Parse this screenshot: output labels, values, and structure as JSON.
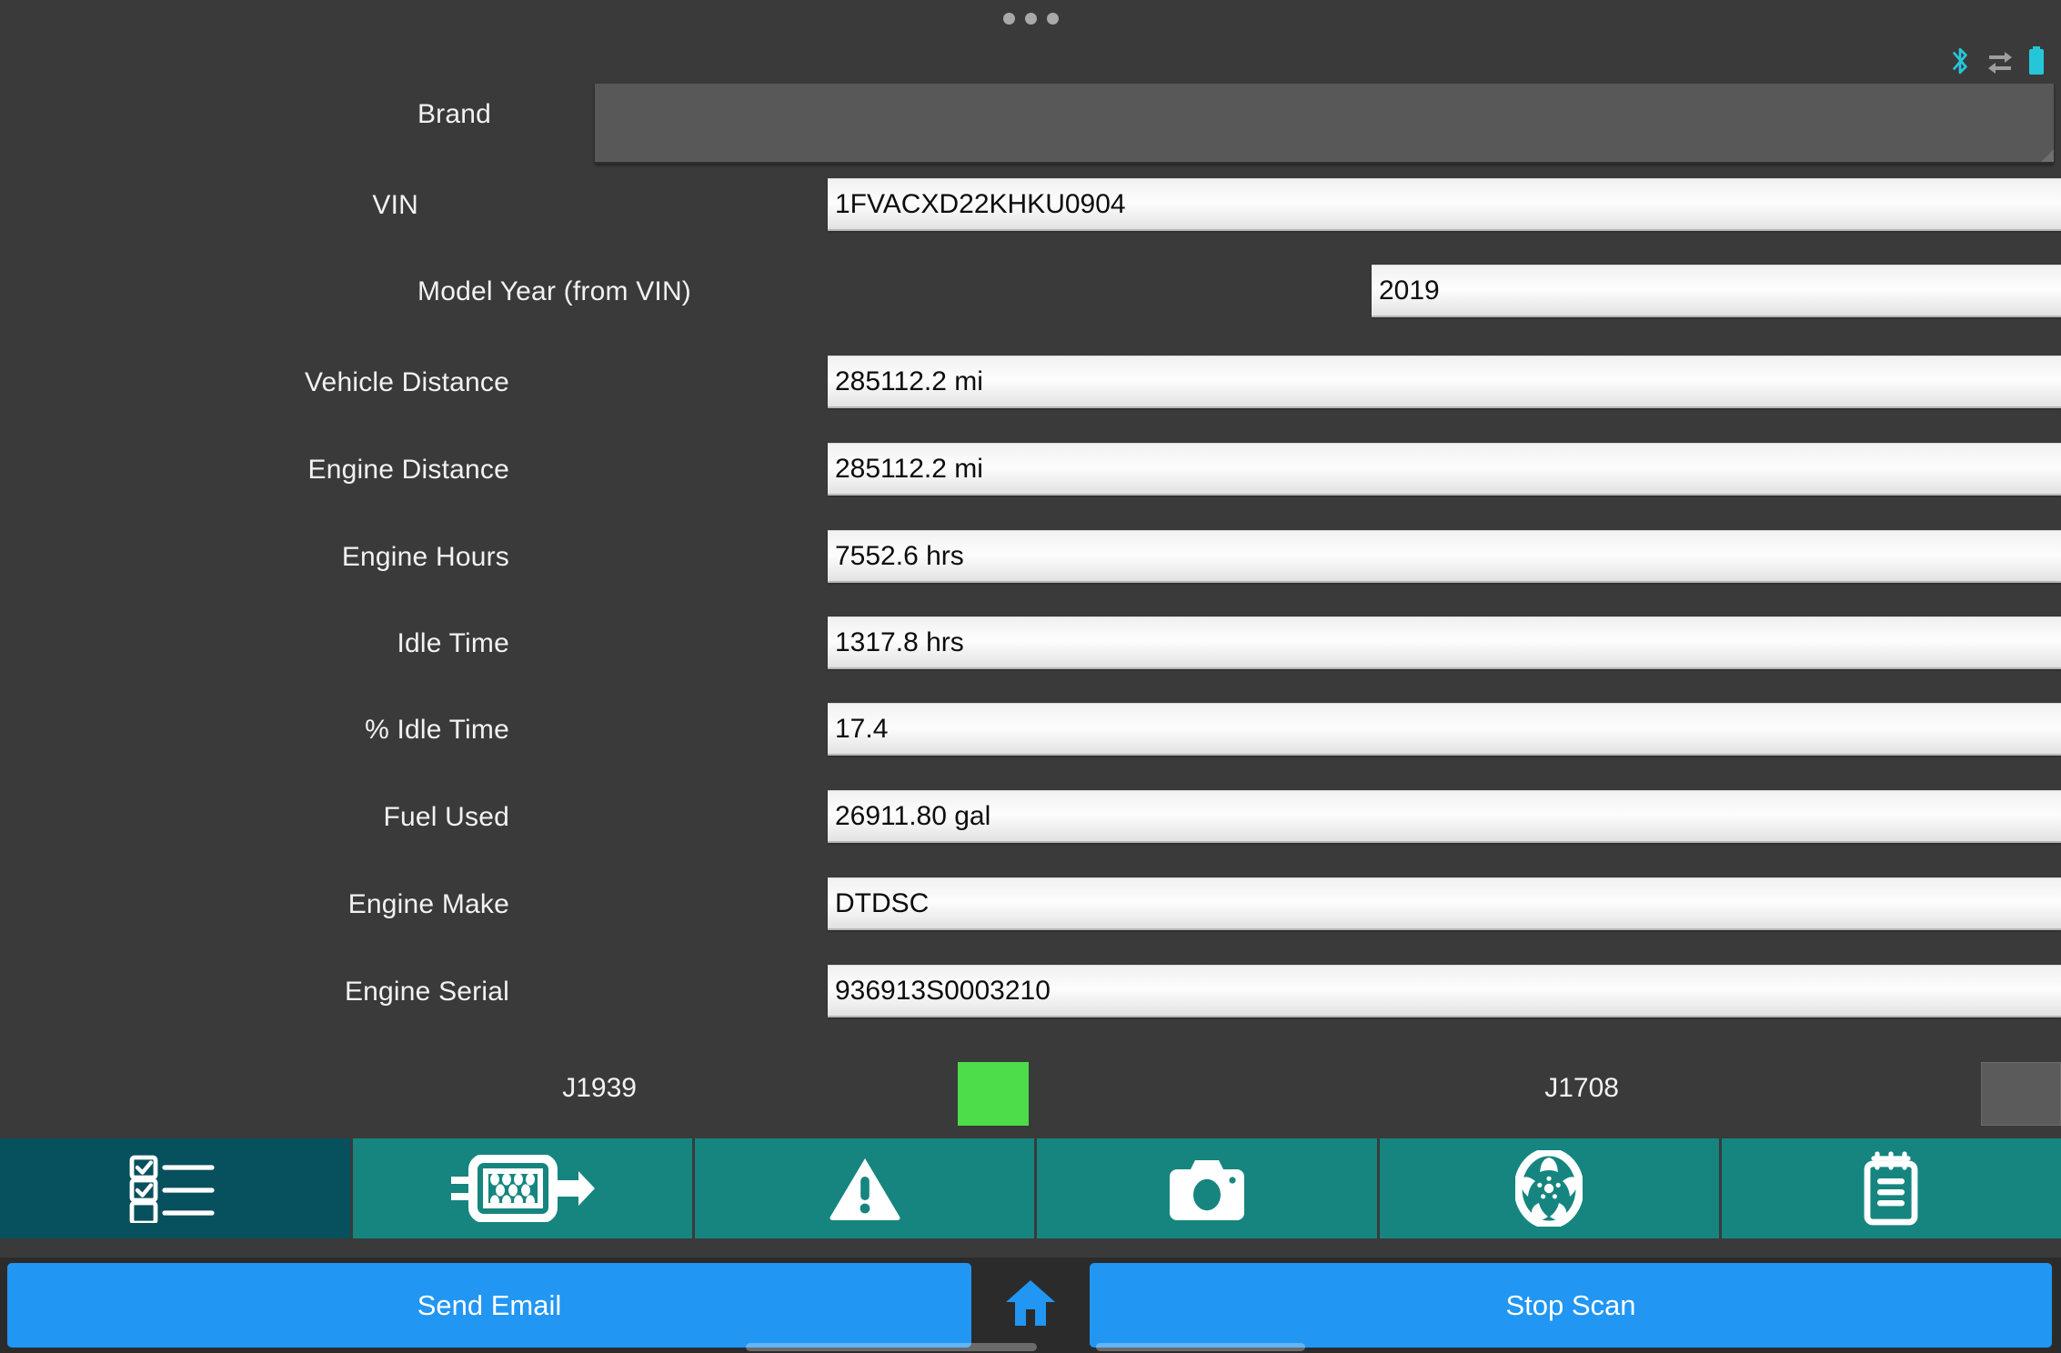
{
  "window": {
    "handle_dots": 3,
    "background_color": "#3a3a3a"
  },
  "status_bar": {
    "icons": [
      {
        "name": "bluetooth-icon",
        "color": "#26c6da"
      },
      {
        "name": "data-transfer-icon",
        "color": "#9e9e9e"
      },
      {
        "name": "battery-icon",
        "color": "#26c6da"
      }
    ]
  },
  "form": {
    "fields": [
      {
        "label": "Brand",
        "value": "",
        "type": "spinner"
      },
      {
        "label": "VIN",
        "value": "1FVACXD22KHKU0904",
        "type": "text"
      },
      {
        "label": "Model Year (from VIN)",
        "value": "2019",
        "type": "text"
      },
      {
        "label": "Vehicle Distance",
        "value": "285112.2 mi",
        "type": "text"
      },
      {
        "label": "Engine Distance",
        "value": "285112.2 mi",
        "type": "text"
      },
      {
        "label": "Engine Hours",
        "value": "7552.6 hrs",
        "type": "text"
      },
      {
        "label": "Idle Time",
        "value": "1317.8 hrs",
        "type": "text"
      },
      {
        "label": "% Idle Time",
        "value": "17.4",
        "type": "text"
      },
      {
        "label": "Fuel Used",
        "value": "26911.80 gal",
        "type": "text"
      },
      {
        "label": "Engine Make",
        "value": "DTDSC",
        "type": "text"
      },
      {
        "label": "Engine Serial",
        "value": "936913S0003210",
        "type": "text"
      }
    ]
  },
  "protocols": [
    {
      "label": "J1939",
      "status": "active",
      "color": "#4ddc4a"
    },
    {
      "label": "J1708",
      "status": "inactive",
      "color": "#5b5b5b"
    }
  ],
  "tabbar": {
    "active_color": "#07505e",
    "inactive_color": "#16857f",
    "tabs": [
      {
        "icon": "checklist-icon",
        "active": true
      },
      {
        "icon": "ecu-connector-icon",
        "active": false
      },
      {
        "icon": "warning-triangle-icon",
        "active": false
      },
      {
        "icon": "camera-icon",
        "active": false
      },
      {
        "icon": "wheel-icon",
        "active": false
      },
      {
        "icon": "notepad-icon",
        "active": false
      }
    ]
  },
  "actionbar": {
    "accent_color": "#2196f3",
    "send_email_label": "Send Email",
    "home_icon": "home-icon",
    "stop_scan_label": "Stop Scan"
  }
}
